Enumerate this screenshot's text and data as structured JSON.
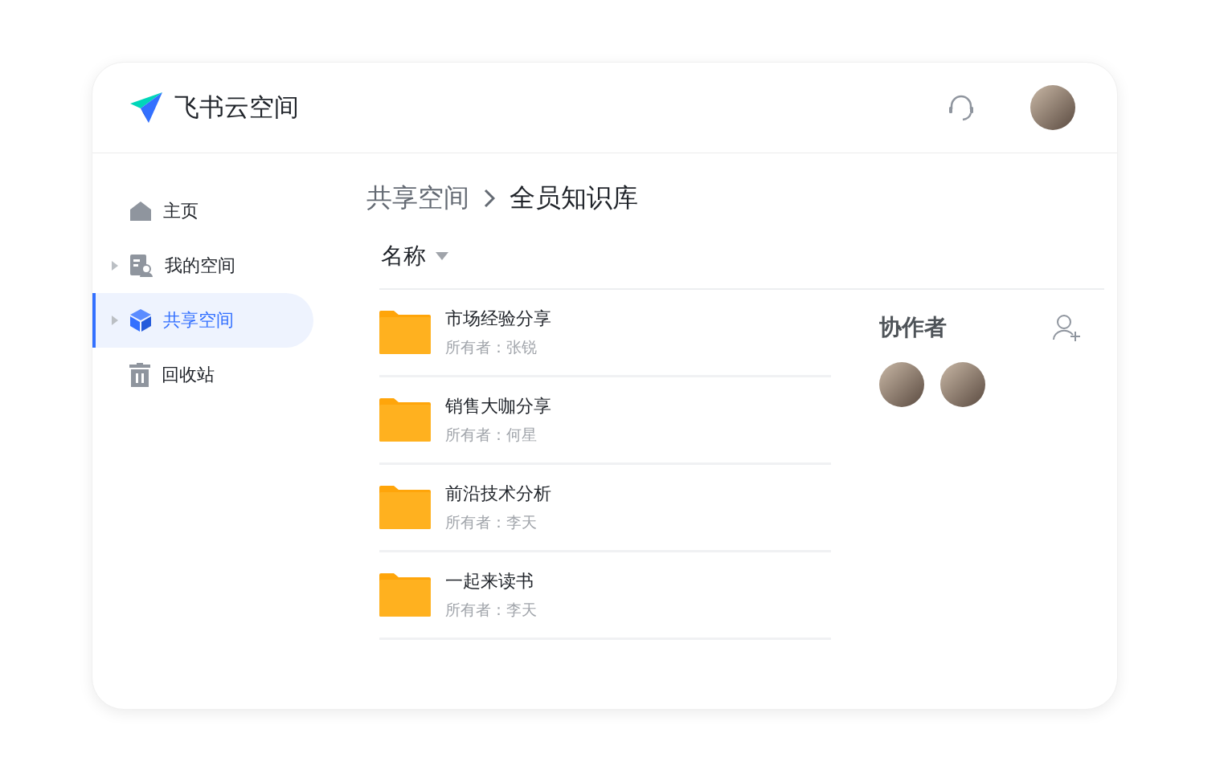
{
  "header": {
    "title": "飞书云空间"
  },
  "sidebar": {
    "items": [
      {
        "label": "主页",
        "kind": "home",
        "expandable": false,
        "selected": false
      },
      {
        "label": "我的空间",
        "kind": "personal",
        "expandable": true,
        "selected": false
      },
      {
        "label": "共享空间",
        "kind": "shared",
        "expandable": true,
        "selected": true
      },
      {
        "label": "回收站",
        "kind": "trash",
        "expandable": false,
        "selected": false
      }
    ]
  },
  "breadcrumb": [
    "共享空间",
    "全员知识库"
  ],
  "list": {
    "column": "名称",
    "rows": [
      {
        "name": "市场经验分享",
        "owner": "所有者：张锐"
      },
      {
        "name": "销售大咖分享",
        "owner": "所有者：何星"
      },
      {
        "name": "前沿技术分析",
        "owner": "所有者：李天"
      },
      {
        "name": "一起来读书",
        "owner": "所有者：李天"
      }
    ]
  },
  "collaborators": {
    "title": "协作者",
    "people": [
      {
        "kind": "person"
      },
      {
        "kind": "person"
      }
    ]
  }
}
